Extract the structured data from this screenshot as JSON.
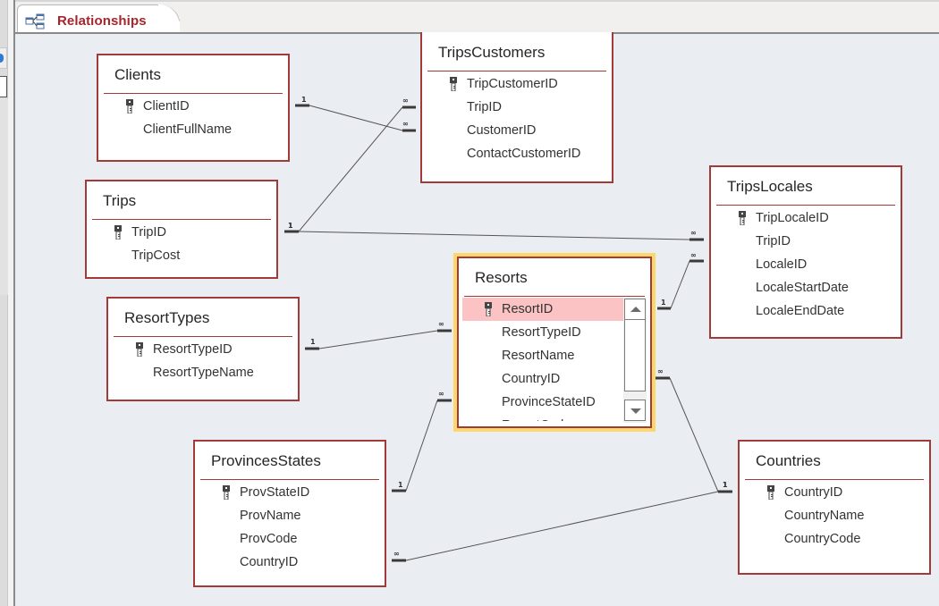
{
  "tab": {
    "label": "Relationships",
    "icon": "relationships-icon"
  },
  "accent": {
    "table_border": "#a33a3a",
    "selected_row": "#fbc3c4",
    "selection_frame": "#fcd86a",
    "tab_label": "#a4262c"
  },
  "tables": [
    {
      "name": "Clients",
      "fields": [
        {
          "name": "ClientID",
          "pk": true
        },
        {
          "name": "ClientFullName",
          "pk": false
        }
      ]
    },
    {
      "name": "TripsCustomers",
      "fields": [
        {
          "name": "TripCustomerID",
          "pk": true
        },
        {
          "name": "TripID",
          "pk": false
        },
        {
          "name": "CustomerID",
          "pk": false
        },
        {
          "name": "ContactCustomerID",
          "pk": false
        }
      ]
    },
    {
      "name": "Trips",
      "fields": [
        {
          "name": "TripID",
          "pk": true
        },
        {
          "name": "TripCost",
          "pk": false
        }
      ]
    },
    {
      "name": "TripsLocales",
      "fields": [
        {
          "name": "TripLocaleID",
          "pk": true
        },
        {
          "name": "TripID",
          "pk": false
        },
        {
          "name": "LocaleID",
          "pk": false
        },
        {
          "name": "LocaleStartDate",
          "pk": false
        },
        {
          "name": "LocaleEndDate",
          "pk": false
        }
      ]
    },
    {
      "name": "Resorts",
      "selected": true,
      "selected_field": "ResortID",
      "fields": [
        {
          "name": "ResortID",
          "pk": true
        },
        {
          "name": "ResortTypeID",
          "pk": false
        },
        {
          "name": "ResortName",
          "pk": false
        },
        {
          "name": "CountryID",
          "pk": false
        },
        {
          "name": "ProvinceStateID",
          "pk": false
        },
        {
          "name": "ResortCode",
          "pk": false
        }
      ]
    },
    {
      "name": "ResortTypes",
      "fields": [
        {
          "name": "ResortTypeID",
          "pk": true
        },
        {
          "name": "ResortTypeName",
          "pk": false
        }
      ]
    },
    {
      "name": "ProvincesStates",
      "fields": [
        {
          "name": "ProvStateID",
          "pk": true
        },
        {
          "name": "ProvName",
          "pk": false
        },
        {
          "name": "ProvCode",
          "pk": false
        },
        {
          "name": "CountryID",
          "pk": false
        }
      ]
    },
    {
      "name": "Countries",
      "fields": [
        {
          "name": "CountryID",
          "pk": true
        },
        {
          "name": "CountryName",
          "pk": false
        },
        {
          "name": "CountryCode",
          "pk": false
        }
      ]
    }
  ],
  "relationships": [
    {
      "from": "Clients.ClientID",
      "to": "TripsCustomers.CustomerID",
      "one_label": "1",
      "many_label": "∞"
    },
    {
      "from": "Trips.TripID",
      "to": "TripsCustomers.TripID",
      "one_label": "1",
      "many_label": "∞"
    },
    {
      "from": "Trips.TripID",
      "to": "TripsLocales.TripID",
      "one_label": "1",
      "many_label": "∞"
    },
    {
      "from": "Resorts.ResortID",
      "to": "TripsLocales.LocaleID",
      "one_label": "1",
      "many_label": "∞"
    },
    {
      "from": "ResortTypes.ResortTypeID",
      "to": "Resorts.ResortTypeID",
      "one_label": "1",
      "many_label": "∞"
    },
    {
      "from": "ProvincesStates.ProvStateID",
      "to": "Resorts.ProvinceStateID",
      "one_label": "1",
      "many_label": "∞"
    },
    {
      "from": "Countries.CountryID",
      "to": "Resorts.CountryID",
      "one_label": "1",
      "many_label": "∞"
    },
    {
      "from": "Countries.CountryID",
      "to": "ProvincesStates.CountryID",
      "one_label": "1",
      "many_label": "∞"
    }
  ]
}
